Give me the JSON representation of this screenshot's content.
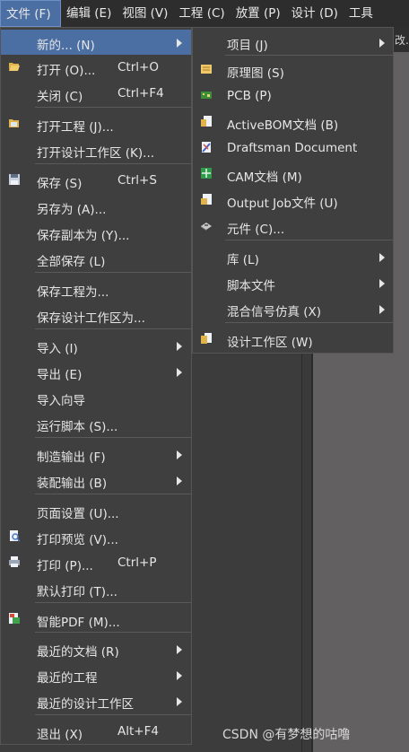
{
  "menubar": {
    "items": [
      {
        "label": "文件 (F)"
      },
      {
        "label": "编辑 (E)"
      },
      {
        "label": "视图 (V)"
      },
      {
        "label": "工程 (C)"
      },
      {
        "label": "放置 (P)"
      },
      {
        "label": "设计 (D)"
      },
      {
        "label": "工具"
      }
    ]
  },
  "tab_fragment": "改.Sc",
  "file_menu": {
    "items": [
      {
        "label": "新的... (N)",
        "shortcut": "",
        "submenu": true,
        "icon": "",
        "highlighted": true
      },
      {
        "label": "打开 (O)...",
        "shortcut": "Ctrl+O",
        "submenu": false,
        "icon": "folder-open-icon"
      },
      {
        "label": "关闭 (C)",
        "shortcut": "Ctrl+F4",
        "submenu": false,
        "icon": ""
      },
      {
        "label": "打开工程 (J)...",
        "shortcut": "",
        "submenu": false,
        "icon": "folder-project-icon"
      },
      {
        "label": "打开设计工作区 (K)...",
        "shortcut": "",
        "submenu": false,
        "icon": ""
      },
      {
        "label": "保存 (S)",
        "shortcut": "Ctrl+S",
        "submenu": false,
        "icon": "save-icon"
      },
      {
        "label": "另存为 (A)...",
        "shortcut": "",
        "submenu": false,
        "icon": ""
      },
      {
        "label": "保存副本为 (Y)...",
        "shortcut": "",
        "submenu": false,
        "icon": ""
      },
      {
        "label": "全部保存 (L)",
        "shortcut": "",
        "submenu": false,
        "icon": ""
      },
      {
        "label": "保存工程为...",
        "shortcut": "",
        "submenu": false,
        "icon": ""
      },
      {
        "label": "保存设计工作区为...",
        "shortcut": "",
        "submenu": false,
        "icon": ""
      },
      {
        "label": "导入 (I)",
        "shortcut": "",
        "submenu": true,
        "icon": ""
      },
      {
        "label": "导出 (E)",
        "shortcut": "",
        "submenu": true,
        "icon": ""
      },
      {
        "label": "导入向导",
        "shortcut": "",
        "submenu": false,
        "icon": ""
      },
      {
        "label": "运行脚本 (S)...",
        "shortcut": "",
        "submenu": false,
        "icon": ""
      },
      {
        "label": "制造输出 (F)",
        "shortcut": "",
        "submenu": true,
        "icon": ""
      },
      {
        "label": "装配输出 (B)",
        "shortcut": "",
        "submenu": true,
        "icon": ""
      },
      {
        "label": "页面设置 (U)...",
        "shortcut": "",
        "submenu": false,
        "icon": ""
      },
      {
        "label": "打印预览 (V)...",
        "shortcut": "",
        "submenu": false,
        "icon": "print-preview-icon"
      },
      {
        "label": "打印 (P)...",
        "shortcut": "Ctrl+P",
        "submenu": false,
        "icon": "printer-icon"
      },
      {
        "label": "默认打印 (T)...",
        "shortcut": "",
        "submenu": false,
        "icon": ""
      },
      {
        "label": "智能PDF (M)...",
        "shortcut": "",
        "submenu": false,
        "icon": "smart-pdf-icon"
      },
      {
        "label": "最近的文档 (R)",
        "shortcut": "",
        "submenu": true,
        "icon": ""
      },
      {
        "label": "最近的工程",
        "shortcut": "",
        "submenu": true,
        "icon": ""
      },
      {
        "label": "最近的设计工作区",
        "shortcut": "",
        "submenu": true,
        "icon": ""
      },
      {
        "label": "退出 (X)",
        "shortcut": "Alt+F4",
        "submenu": false,
        "icon": ""
      }
    ]
  },
  "new_submenu": {
    "items": [
      {
        "label": "项目 (J)",
        "submenu": true,
        "icon": ""
      },
      {
        "label": "原理图 (S)",
        "submenu": false,
        "icon": "schematic-icon"
      },
      {
        "label": "PCB (P)",
        "submenu": false,
        "icon": "pcb-icon"
      },
      {
        "label": "ActiveBOM文档 (B)",
        "submenu": false,
        "icon": "activebom-icon"
      },
      {
        "label": "Draftsman Document",
        "submenu": false,
        "icon": "draftsman-icon"
      },
      {
        "label": "CAM文档 (M)",
        "submenu": false,
        "icon": "cam-icon"
      },
      {
        "label": "Output Job文件 (U)",
        "submenu": false,
        "icon": "output-job-icon"
      },
      {
        "label": "元件 (C)...",
        "submenu": false,
        "icon": "component-icon"
      },
      {
        "label": "库 (L)",
        "submenu": true,
        "icon": ""
      },
      {
        "label": "脚本文件",
        "submenu": true,
        "icon": ""
      },
      {
        "label": "混合信号仿真 (X)",
        "submenu": true,
        "icon": ""
      },
      {
        "label": "设计工作区 (W)",
        "submenu": false,
        "icon": "workspace-icon"
      }
    ]
  },
  "watermark": "CSDN @有梦想的咕噜",
  "colors": {
    "highlight": "#4c6fa3",
    "menu_bg": "#3f3f3f",
    "menubar_bg": "#2d2d2d"
  }
}
